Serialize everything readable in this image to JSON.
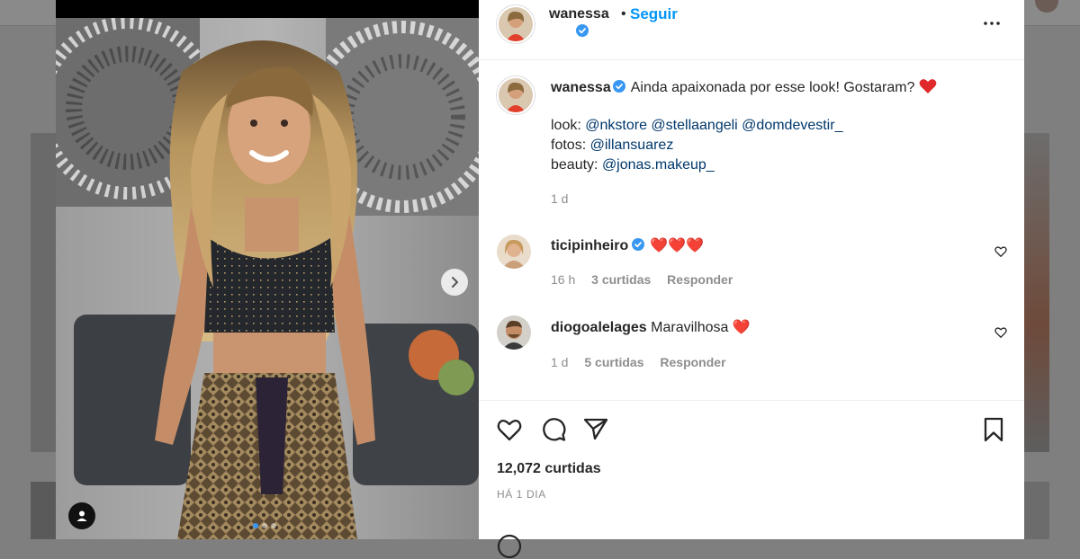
{
  "post": {
    "author": {
      "username": "wanessa",
      "follow_label": "Seguir",
      "separator": "•"
    },
    "caption": {
      "text": "Ainda apaixonada por esse look! Gostaram?",
      "look_label": "look:",
      "look_mentions": [
        "@nkstore",
        "@stellaangeli",
        "@domdevestir_"
      ],
      "photos_label": "fotos:",
      "photos_mention": "@illansuarez",
      "beauty_label": "beauty:",
      "beauty_mention": "@jonas.makeup_",
      "time": "1 d"
    },
    "comments": [
      {
        "username": "ticipinheiro",
        "text": "❤️❤️❤️",
        "verified": true,
        "time": "16 h",
        "likes": "3 curtidas",
        "reply": "Responder"
      },
      {
        "username": "diogoalelages",
        "text": "Maravilhosa ❤️",
        "verified": false,
        "time": "1 d",
        "likes": "5 curtidas",
        "reply": "Responder"
      }
    ],
    "likes_count": "12,072 curtidas",
    "date_label": "HÁ 1 DIA",
    "carousel": {
      "count": 3,
      "active": 0
    }
  },
  "icons": [
    "more-icon",
    "heart-icon",
    "comment-icon",
    "share-icon",
    "bookmark-icon",
    "next-arrow-icon",
    "user-tag-icon",
    "verified-badge-icon",
    "emoji-icon"
  ],
  "colors": {
    "link_blue": "#0095f6",
    "mention_blue": "#00376b",
    "meta_gray": "#8e8e8e",
    "verified_blue": "#3897f0",
    "heart_red": "#ed4956"
  }
}
